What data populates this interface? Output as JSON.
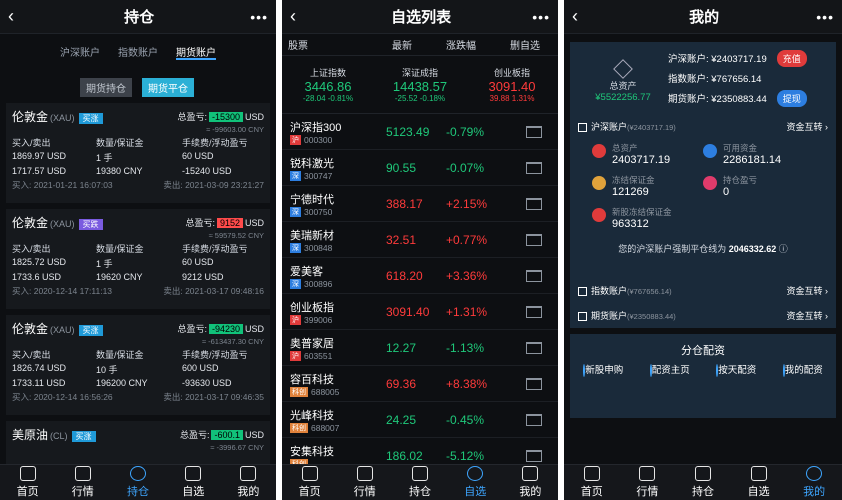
{
  "positions": {
    "title": "持仓",
    "account_tabs": [
      "沪深账户",
      "指数账户",
      "期货账户"
    ],
    "mode_tabs": [
      "期货持仓",
      "期货平仓"
    ],
    "cards": [
      {
        "name": "伦敦金",
        "code": "(XAU)",
        "badge": "买涨",
        "total_label": "总盈亏:",
        "total_value": "-15300",
        "total_unit": "USD",
        "sub": "≈ -99603.00 CNY",
        "h1": "买入/卖出",
        "h2": "数量/保证金",
        "h3": "手续费/浮动盈亏",
        "a1": "1869.97 USD",
        "b1": "1 手",
        "c1": "60 USD",
        "a2": "1717.57 USD",
        "b2": "19380 CNY",
        "c2": "-15240 USD",
        "buy": "买入: 2021-01-21 16:07:03",
        "sell": "卖出: 2021-03-09 23:21:27"
      },
      {
        "name": "伦敦金",
        "code": "(XAU)",
        "badge": "买跌",
        "total_label": "总盈亏:",
        "total_value": "9152",
        "total_unit": "USD",
        "sub": "≈ 59579.52 CNY",
        "h1": "买入/卖出",
        "h2": "数量/保证金",
        "h3": "手续费/浮动盈亏",
        "a1": "1825.72 USD",
        "b1": "1 手",
        "c1": "60 USD",
        "a2": "1733.6 USD",
        "b2": "19620 CNY",
        "c2": "9212 USD",
        "buy": "买入: 2020-12-14 17:11:13",
        "sell": "卖出: 2021-03-17 09:48:16"
      },
      {
        "name": "伦敦金",
        "code": "(XAU)",
        "badge": "买涨",
        "total_label": "总盈亏:",
        "total_value": "-94230",
        "total_unit": "USD",
        "sub": "≈ -613437.30 CNY",
        "h1": "买入/卖出",
        "h2": "数量/保证金",
        "h3": "手续费/浮动盈亏",
        "a1": "1826.74 USD",
        "b1": "10 手",
        "c1": "600 USD",
        "a2": "1733.11 USD",
        "b2": "196200 CNY",
        "c2": "-93630 USD",
        "buy": "买入: 2020-12-14 16:56:26",
        "sell": "卖出: 2021-03-17 09:46:35"
      },
      {
        "name": "美原油",
        "code": "(CL)",
        "badge": "买涨",
        "total_label": "总盈亏:",
        "total_value": "-600.1",
        "total_unit": "USD",
        "sub": "≈ -3996.67 CNY",
        "h1": "",
        "h2": "",
        "h3": "",
        "a1": "",
        "b1": "",
        "c1": "",
        "a2": "",
        "b2": "",
        "c2": "",
        "buy": "",
        "sell": ""
      }
    ]
  },
  "watchlist": {
    "title": "自选列表",
    "columns": [
      "股票",
      "最新",
      "涨跌幅",
      "删自选"
    ],
    "indices": [
      {
        "name": "上证指数",
        "price": "3446.86",
        "change": "-28.04 -0.81%"
      },
      {
        "name": "深证成指",
        "price": "14438.57",
        "change": "-25.52 -0.18%"
      },
      {
        "name": "创业板指",
        "price": "3091.40",
        "change": "39.88 1.31%"
      }
    ],
    "rows": [
      {
        "name": "沪深指300",
        "tag": "沪",
        "code": "000300",
        "price": "5123.49",
        "chg": "-0.79%"
      },
      {
        "name": "锐科激光",
        "tag": "深",
        "code": "300747",
        "price": "90.55",
        "chg": "-0.07%"
      },
      {
        "name": "宁德时代",
        "tag": "深",
        "code": "300750",
        "price": "388.17",
        "chg": "+2.15%"
      },
      {
        "name": "美瑞新材",
        "tag": "深",
        "code": "300848",
        "price": "32.51",
        "chg": "+0.77%"
      },
      {
        "name": "爱美客",
        "tag": "深",
        "code": "300896",
        "price": "618.20",
        "chg": "+3.36%"
      },
      {
        "name": "创业板指",
        "tag": "沪",
        "code": "399006",
        "price": "3091.40",
        "chg": "+1.31%"
      },
      {
        "name": "奥普家居",
        "tag": "沪",
        "code": "603551",
        "price": "12.27",
        "chg": "-1.13%"
      },
      {
        "name": "容百科技",
        "tag": "科创",
        "code": "688005",
        "price": "69.36",
        "chg": "+8.38%"
      },
      {
        "name": "光峰科技",
        "tag": "科创",
        "code": "688007",
        "price": "24.25",
        "chg": "-0.45%"
      },
      {
        "name": "安集科技",
        "tag": "科创",
        "code": "",
        "price": "186.02",
        "chg": "-5.12%"
      }
    ]
  },
  "mine": {
    "title": "我的",
    "total_label": "总资产",
    "total_value": "¥5522256.77",
    "acc_hs": "沪深账户: ¥2403717.19",
    "acc_zs": "指数账户: ¥767656.14",
    "acc_qh": "期货账户: ¥2350883.44",
    "btn_recharge": "充值",
    "btn_withdraw": "提现",
    "hs_header": "沪深账户",
    "hs_amount": "(¥2403717.19)",
    "transfer": "资金互转",
    "kv": [
      {
        "label": "总资产",
        "value": "2403717.19"
      },
      {
        "label": "可用资金",
        "value": "2286181.14"
      },
      {
        "label": "冻结保证金",
        "value": "121269"
      },
      {
        "label": "持仓盈亏",
        "value": "0"
      },
      {
        "label": "新股冻结保证金",
        "value": "963312"
      }
    ],
    "warn_text": "您的沪深账户强制平仓线为",
    "warn_value": "2046332.62",
    "zs_header": "指数账户",
    "zs_amount": "(¥767656.14)",
    "qh_header": "期货账户",
    "qh_amount": "(¥2350883.44)",
    "split_title": "分仓配资",
    "split_items": [
      "新股申购",
      "配资主页",
      "按天配资",
      "我的配资"
    ]
  },
  "tabbar": [
    "首页",
    "行情",
    "持仓",
    "自选",
    "我的"
  ]
}
